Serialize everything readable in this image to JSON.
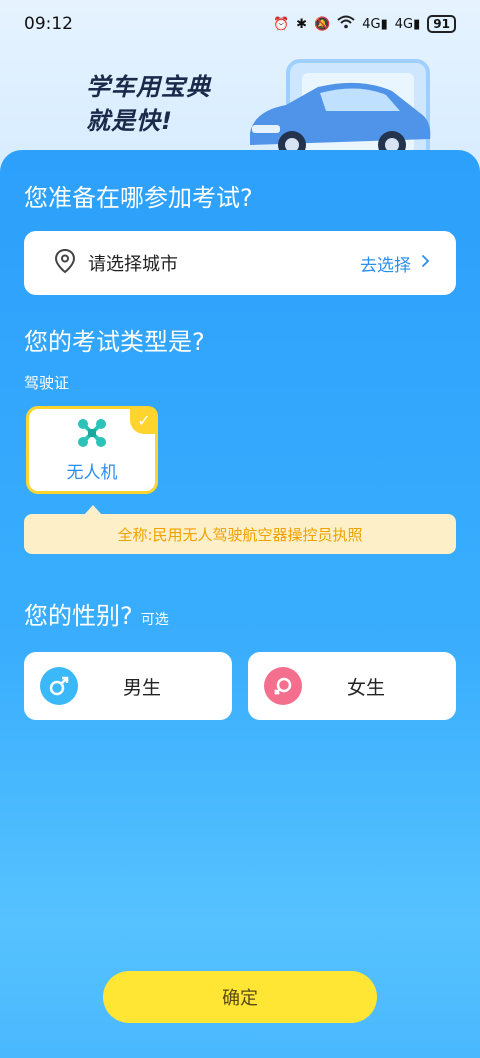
{
  "status_bar": {
    "time": "09:12",
    "network_1": "4G",
    "network_2": "4G",
    "battery": "91"
  },
  "banner": {
    "line1": "学车用宝典",
    "line2": "就是快!"
  },
  "city_section": {
    "title": "您准备在哪参加考试?",
    "placeholder": "请选择城市",
    "action": "去选择"
  },
  "exam_section": {
    "title": "您的考试类型是?",
    "license_label": "驾驶证",
    "option_name": "无人机",
    "fullname": "全称:民用无人驾驶航空器操控员执照"
  },
  "gender_section": {
    "title": "您的性别?",
    "optional": "可选",
    "male": "男生",
    "female": "女生"
  },
  "confirm": "确定",
  "colors": {
    "panel": "#2ca0fb",
    "accent": "#ffd42e",
    "button": "#ffe534",
    "male": "#3ab8f7",
    "female": "#f46f8e"
  }
}
